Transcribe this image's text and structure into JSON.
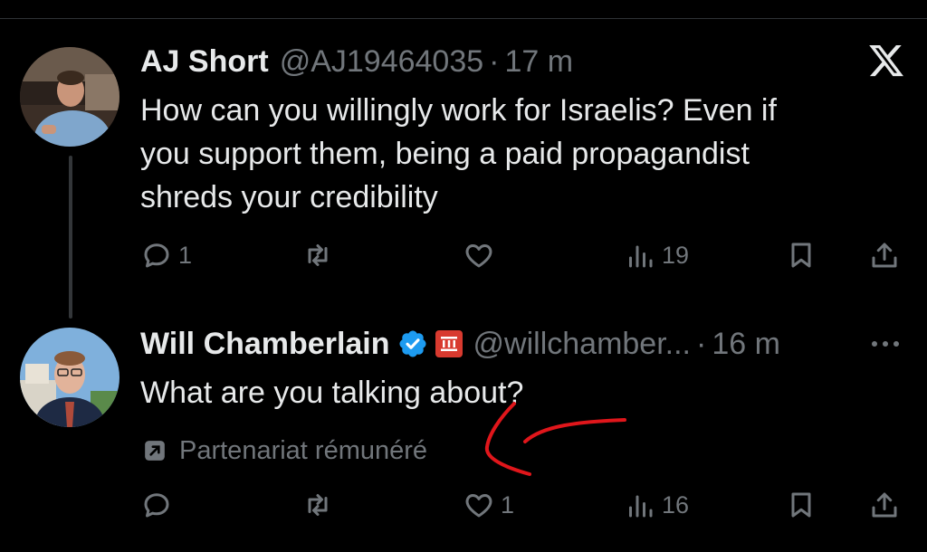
{
  "tweets": [
    {
      "name": "AJ Short",
      "handle": "@AJ19464035",
      "separator": "·",
      "time": "17 m",
      "text_lines": [
        "How can you willingly work for Israelis? Even if",
        "you support them, being a paid propagandist",
        "shreds your credibility"
      ],
      "stats": {
        "replies": "1",
        "reposts": "",
        "likes": "",
        "views": "19"
      }
    },
    {
      "name": "Will Chamberlain",
      "handle": "@willchamber...",
      "separator": "·",
      "time": "16 m",
      "text_lines": [
        "What are you talking about?"
      ],
      "paid_label": "Partenariat rémunéré",
      "stats": {
        "replies": "",
        "reposts": "",
        "likes": "1",
        "views": "16"
      }
    }
  ],
  "icons": {
    "app": "x-logo-icon",
    "reply": "reply-icon",
    "repost": "repost-icon",
    "like": "like-icon",
    "views": "views-icon",
    "bookmark": "bookmark-icon",
    "share": "share-icon",
    "verified": "verified-badge-icon",
    "more": "more-icon"
  },
  "colors": {
    "background": "#000000",
    "text": "#e7e9ea",
    "muted": "#71767b",
    "verified": "#1d9bf0",
    "annotation": "#e0161b"
  }
}
